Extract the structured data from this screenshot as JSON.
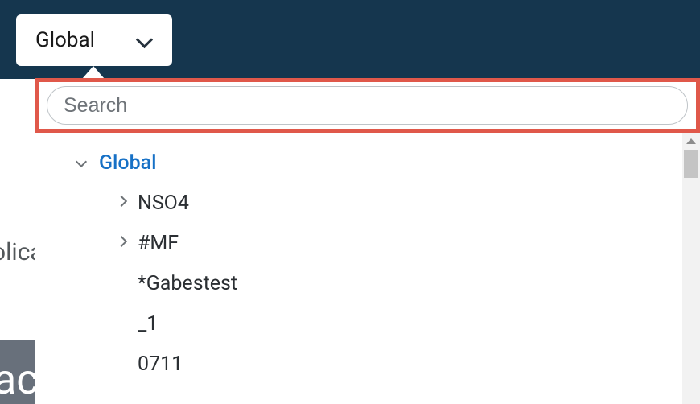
{
  "selector": {
    "current_label": "Global"
  },
  "search": {
    "placeholder": "Search",
    "value": ""
  },
  "background": {
    "left_fragment": "olica",
    "band_fragment": "ac"
  },
  "tree": {
    "root": {
      "label": "Global",
      "expanded": true,
      "children": [
        {
          "label": "NSO4",
          "expandable": true,
          "expanded": false
        },
        {
          "label": "#MF",
          "expandable": true,
          "expanded": false
        },
        {
          "label": "*Gabestest",
          "expandable": false,
          "expanded": false
        },
        {
          "label": "_1",
          "expandable": false,
          "expanded": false
        },
        {
          "label": "0711",
          "expandable": false,
          "expanded": false
        }
      ]
    }
  },
  "colors": {
    "topbar_bg": "#15364e",
    "highlight_border": "#e0584a",
    "link_blue": "#1771c6",
    "band_bg": "#68707b"
  }
}
